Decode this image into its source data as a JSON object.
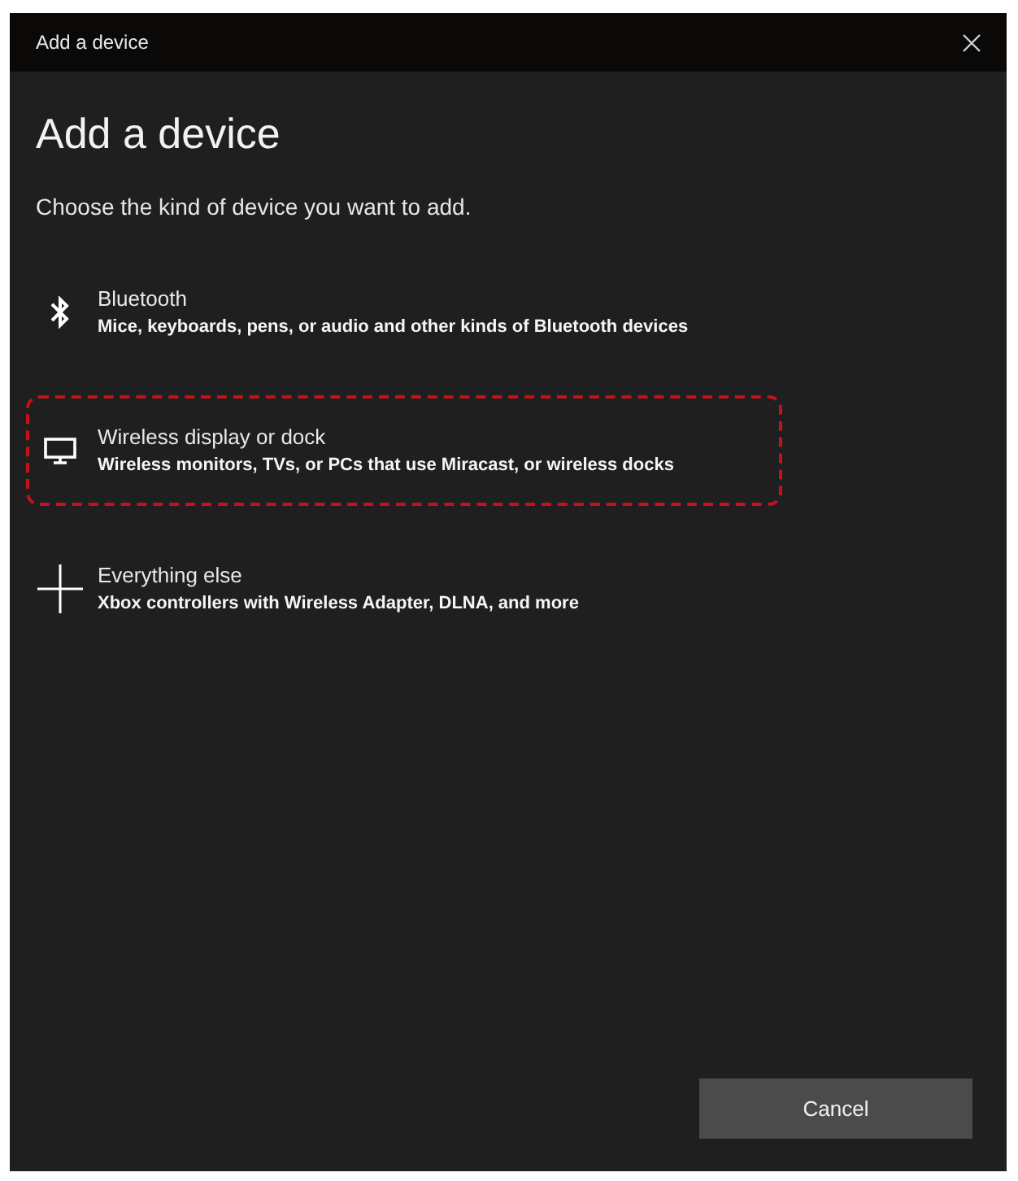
{
  "window": {
    "title": "Add a device"
  },
  "heading": "Add a device",
  "subtitle": "Choose the kind of device you want to add.",
  "items": [
    {
      "kind": "bluetooth",
      "title": "Bluetooth",
      "description": "Mice, keyboards, pens, or audio and other kinds of Bluetooth devices",
      "highlighted": false
    },
    {
      "kind": "display",
      "title": "Wireless display or dock",
      "description": "Wireless monitors, TVs, or PCs that use Miracast, or wireless docks",
      "highlighted": true
    },
    {
      "kind": "plus",
      "title": "Everything else",
      "description": "Xbox controllers with Wireless Adapter, DLNA, and more",
      "highlighted": false
    }
  ],
  "buttons": [
    "Cancel"
  ]
}
